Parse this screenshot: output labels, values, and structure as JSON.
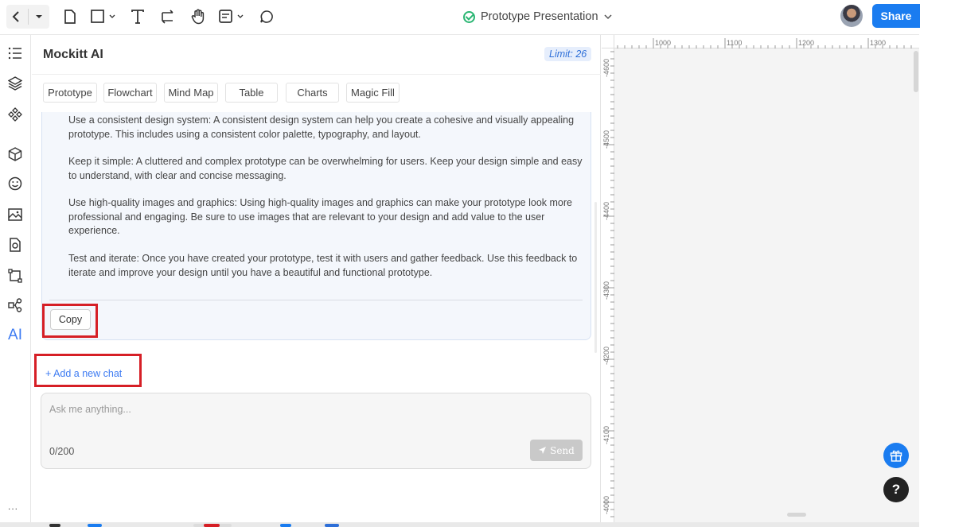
{
  "topbar": {
    "project_title": "Prototype Presentation",
    "share_label": "Share",
    "icons": [
      "back-arrow-icon",
      "chevron-down-icon",
      "page-icon",
      "rectangle-icon",
      "text-icon",
      "connector-icon",
      "hand-icon",
      "note-icon",
      "comment-icon"
    ]
  },
  "rail": {
    "icons": [
      "outline-icon",
      "layers-icon",
      "components-icon",
      "box-icon",
      "emoji-icon",
      "image-icon",
      "plugin-icon",
      "crop-icon",
      "flow-icon"
    ],
    "ai_label": "AI",
    "more_label": "..."
  },
  "panel": {
    "title": "Mockitt AI",
    "limit": "Limit: 26",
    "tabs": [
      "Prototype",
      "Flowchart",
      "Mind Map",
      "Table",
      "Charts",
      "Magic Fill"
    ],
    "response_paragraphs": [
      "Use a consistent design system: A consistent design system can help you create a cohesive and visually appealing prototype. This includes using a consistent color palette, typography, and layout.",
      "Keep it simple: A cluttered and complex prototype can be overwhelming for users. Keep your design simple and easy to understand, with clear and concise messaging.",
      "Use high-quality images and graphics: Using high-quality images and graphics can make your prototype look more professional and engaging. Be sure to use images that are relevant to your design and add value to the user experience.",
      "Test and iterate: Once you have created your prototype, test it with users and gather feedback. Use this feedback to iterate and improve your design until you have a beautiful and functional prototype."
    ],
    "copy_label": "Copy",
    "add_chat_label": "+ Add a new chat",
    "input_placeholder": "Ask me anything...",
    "counter": "0/200",
    "send_label": "Send"
  },
  "canvas": {
    "h_ticks": [
      "1000",
      "1100",
      "1200",
      "1300"
    ],
    "v_ticks": [
      "-4600",
      "-4500",
      "-4400",
      "-4300",
      "-4200",
      "-4100",
      "-4000"
    ]
  },
  "colors": {
    "accent": "#1a7cf0",
    "highlight_box": "#d61f26",
    "status_green": "#2bb673"
  }
}
